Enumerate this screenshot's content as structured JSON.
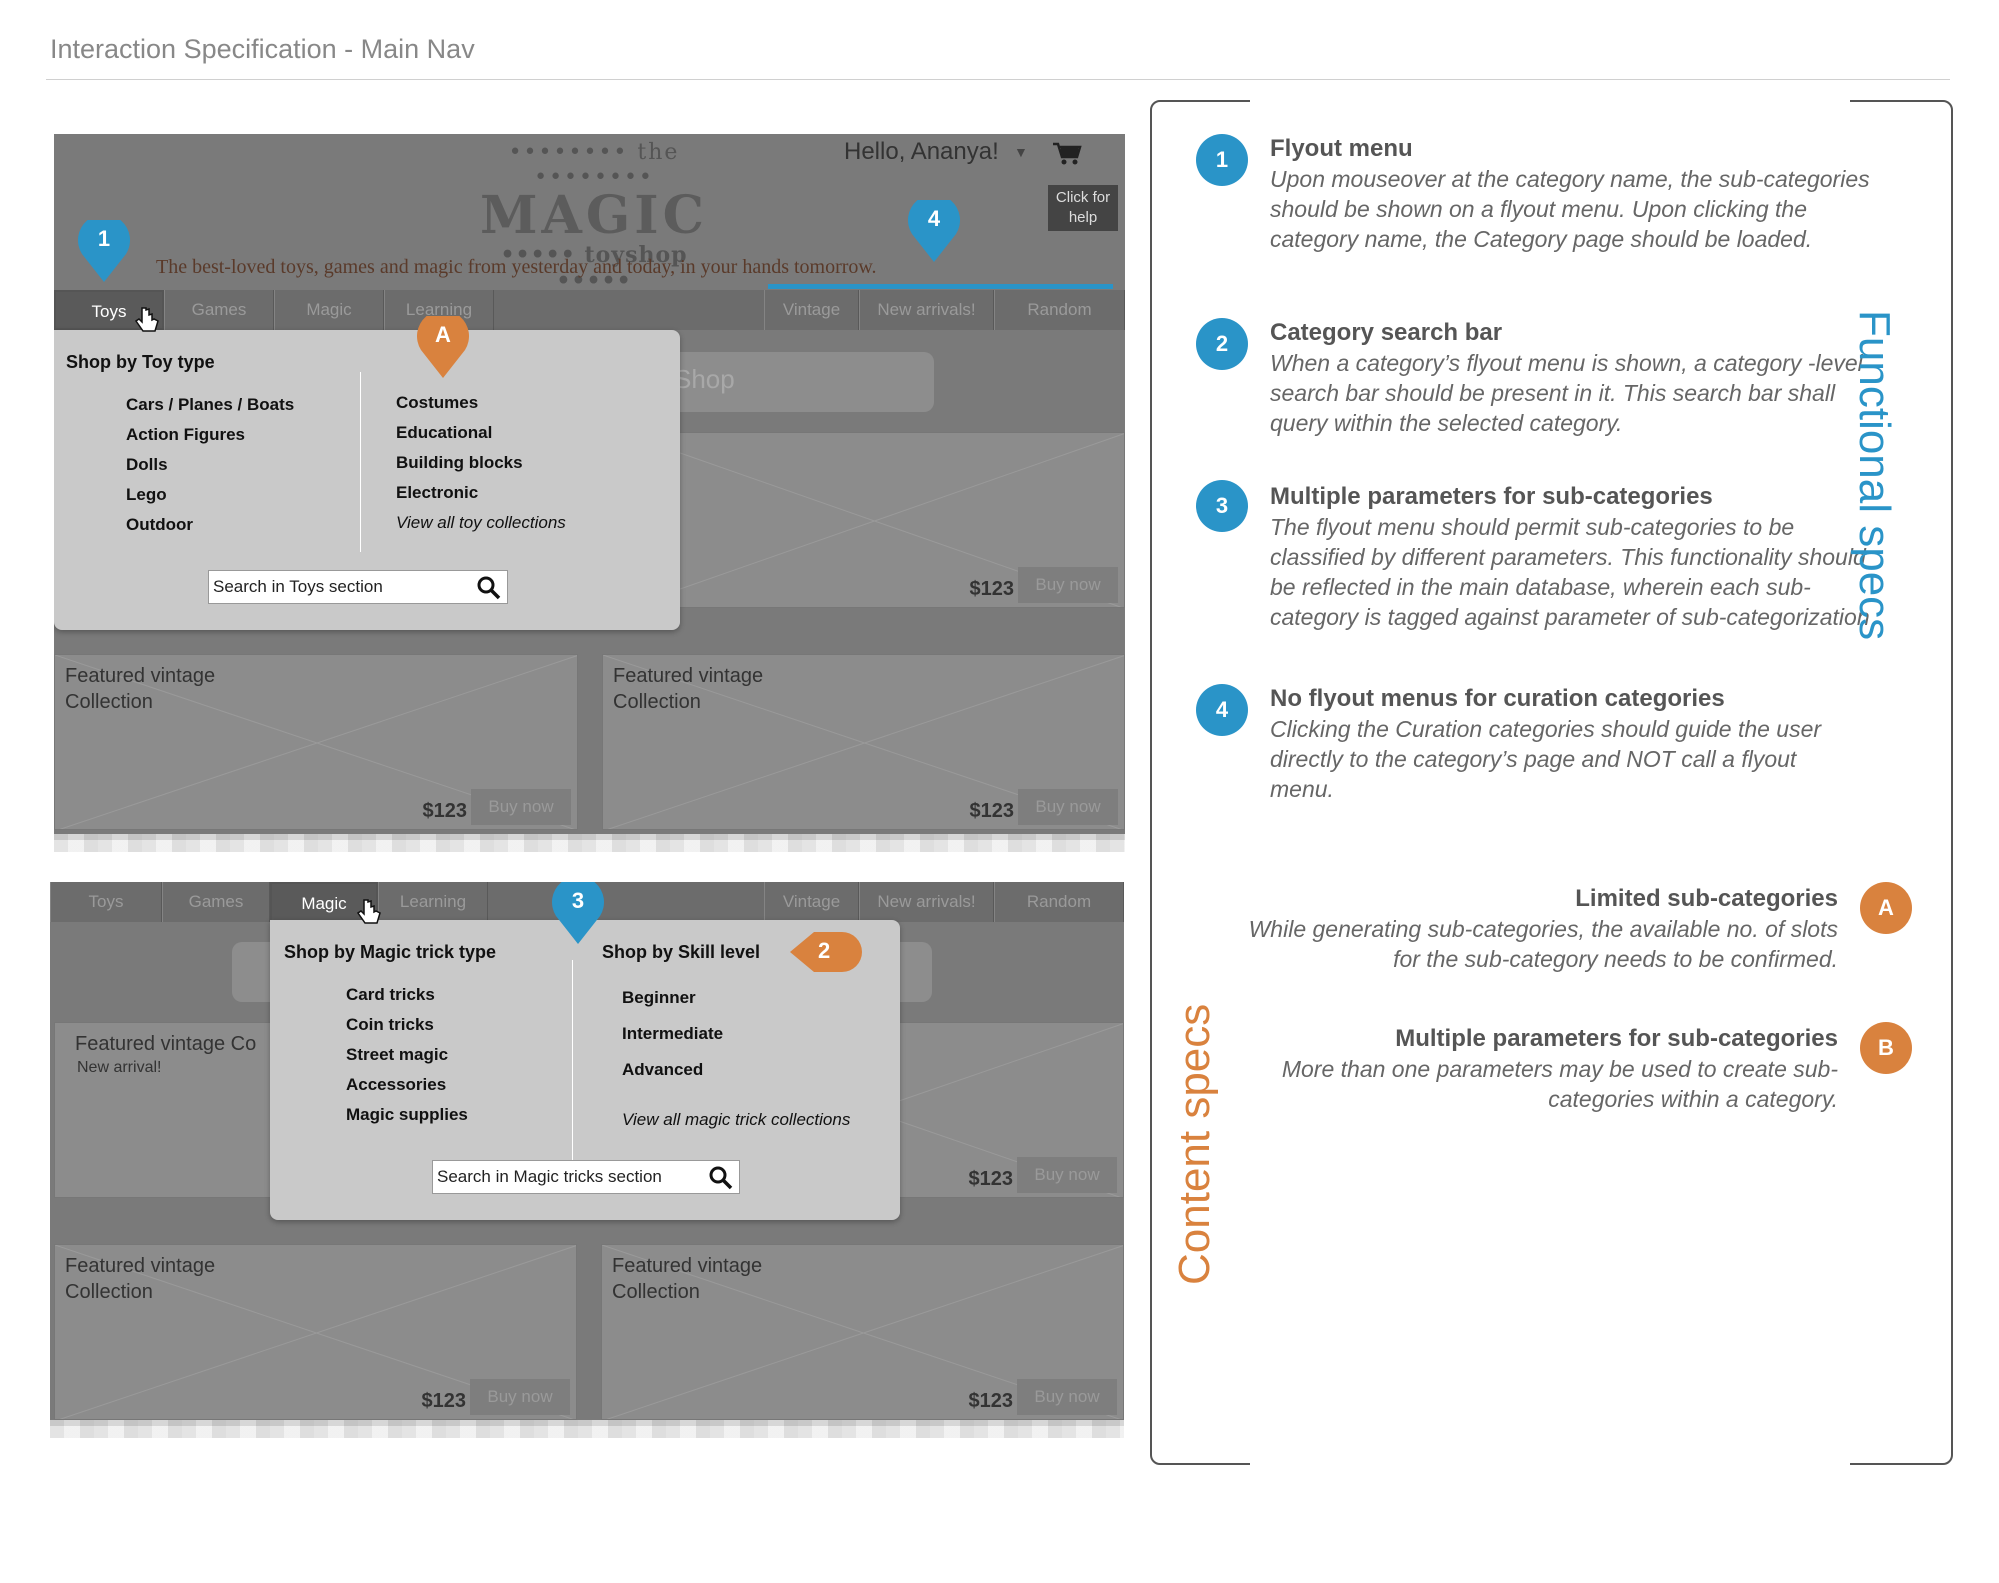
{
  "page": {
    "title": "Interaction Specification - Main Nav"
  },
  "colors": {
    "blue": "#2a94c8",
    "orange": "#d9823e"
  },
  "site": {
    "logo_top": "•••••••• the ••••••••",
    "logo_main": "MAGIC",
    "logo_bottom": "••••• toyshop •••••",
    "tagline": "The best-loved toys, games and magic from yesterday and today, in your hands tomorrow.",
    "greeting": "Hello, Ananya!",
    "help": "Click for help",
    "search_placeholder": "Shop"
  },
  "nav": {
    "toys": "Toys",
    "games": "Games",
    "magic": "Magic",
    "learning": "Learning",
    "vintage": "Vintage",
    "new_arrivals": "New arrivals!",
    "random": "Random"
  },
  "toys_flyout": {
    "heading": "Shop by Toy type",
    "col1": [
      "Cars / Planes / Boats",
      "Action Figures",
      "Dolls",
      "Lego",
      "Outdoor"
    ],
    "col2": [
      "Costumes",
      "Educational",
      "Building blocks",
      "Electronic"
    ],
    "view_all": "View all toy collections",
    "search": "Search in Toys section"
  },
  "magic_flyout": {
    "heading1": "Shop by Magic trick type",
    "col1": [
      "Card tricks",
      "Coin tricks",
      "Street magic",
      "Accessories",
      "Magic supplies"
    ],
    "heading2": "Shop by Skill level",
    "col2": [
      "Beginner",
      "Intermediate",
      "Advanced"
    ],
    "view_all": "View all magic trick collections",
    "search": "Search in Magic tricks section"
  },
  "cards": {
    "title": "Featured vintage Collection",
    "title_short": "Featured vintage Co",
    "new_arrival": "New arrival!",
    "price": "$123",
    "buy": "Buy now"
  },
  "markers": {
    "one": "1",
    "two": "2",
    "three": "3",
    "four": "4",
    "a": "A",
    "b": "B"
  },
  "functional_specs": [
    {
      "num": "1",
      "title": "Flyout menu",
      "desc": "Upon mouseover at the category name, the sub-categories should be shown on a flyout menu. Upon clicking the category name, the Category page should be loaded."
    },
    {
      "num": "2",
      "title": "Category search bar",
      "desc": "When a category’s flyout menu is shown, a category -level search bar should be present in it. This search bar shall query within the selected category."
    },
    {
      "num": "3",
      "title": "Multiple parameters for sub-categories",
      "desc": "The flyout menu should permit sub-categories to be classified by different parameters. This functionality should be reflected in the main database, wherein each sub-category is tagged against parameter of sub-categorization"
    },
    {
      "num": "4",
      "title": "No flyout menus for curation categories",
      "desc": "Clicking the Curation categories should guide the user directly to the category’s page and NOT call a flyout menu."
    }
  ],
  "content_specs": [
    {
      "num": "A",
      "title": "Limited sub-categories",
      "desc": "While generating sub-categories, the available  no. of slots for the sub-category needs to be confirmed."
    },
    {
      "num": "B",
      "title": "Multiple parameters for sub-categories",
      "desc": "More than one parameters may be used to  create sub-categories within a category."
    }
  ],
  "labels": {
    "functional": "Functional specs",
    "content": "Content specs"
  }
}
